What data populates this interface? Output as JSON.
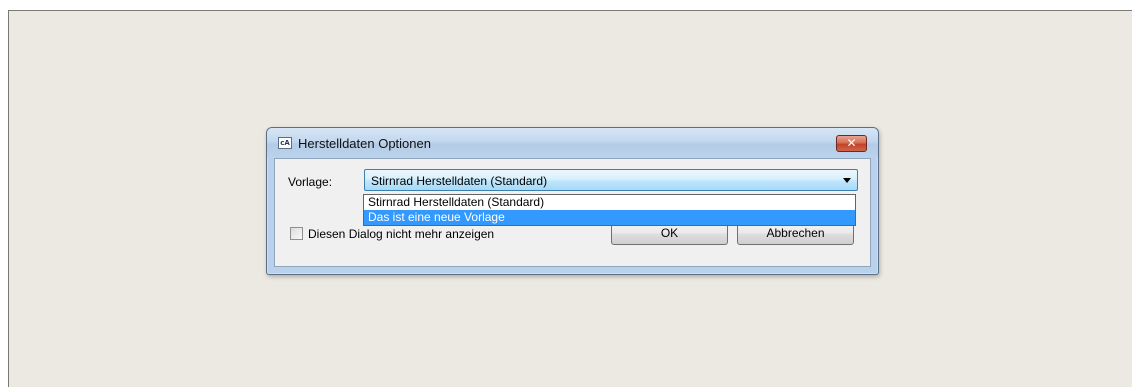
{
  "dialog": {
    "title": "Herstelldaten Optionen",
    "app_icon_text": "cA",
    "close_symbol": "✕",
    "template_label": "Vorlage:",
    "template_selected": "Stirnrad Herstelldaten (Standard)",
    "template_options": [
      "Stirnrad Herstelldaten (Standard)",
      "Das ist eine neue Vorlage"
    ],
    "highlighted_option_index": 1,
    "dont_show_label": "Diesen Dialog nicht mehr anzeigen",
    "dont_show_checked": false,
    "ok_label": "OK",
    "cancel_label": "Abbrechen"
  },
  "colors": {
    "highlight": "#3399ff",
    "desktop": "#ebe9e1",
    "close_button": "#c2432a"
  },
  "icons": {
    "app": "app-icon",
    "close": "close-icon",
    "dropdown": "chevron-down-icon"
  }
}
